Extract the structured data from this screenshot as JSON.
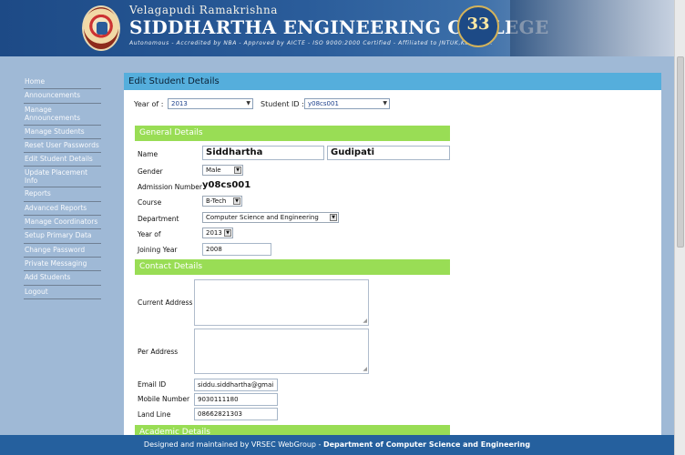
{
  "header": {
    "subtitle": "Velagapudi Ramakrishna",
    "college_name": "SIDDHARTHA ENGINEERING COLLEGE",
    "tagline": "Autonomous - Accredited by NBA - Approved by AICTE - ISO 9000:2000 Certified - Affiliated to JNTUK,Kakinada.",
    "badge_number": "33"
  },
  "sidebar": {
    "items": [
      {
        "label": "Home"
      },
      {
        "label": "Announcements"
      },
      {
        "label": "Manage Announcements"
      },
      {
        "label": "Manage Students"
      },
      {
        "label": "Reset User Passwords"
      },
      {
        "label": "Edit Student Details"
      },
      {
        "label": "Update Placement Info"
      },
      {
        "label": "Reports"
      },
      {
        "label": "Advanced Reports"
      },
      {
        "label": "Manage Coordinators"
      },
      {
        "label": "Setup Primary Data"
      },
      {
        "label": "Change Password"
      },
      {
        "label": "Private Messaging"
      },
      {
        "label": "Add Students"
      },
      {
        "label": "Logout"
      }
    ]
  },
  "panel": {
    "title": "Edit Student Details",
    "filters": {
      "year_label": "Year of :",
      "year_value": "2013",
      "student_id_label": "Student ID :",
      "student_id_value": "y08cs001"
    },
    "general": {
      "heading": "General Details",
      "name_label": "Name",
      "first_name": "Siddhartha",
      "last_name": "Gudipati",
      "gender_label": "Gender",
      "gender_value": "Male",
      "admission_label": "Admission Number",
      "admission_value": "y08cs001",
      "course_label": "Course",
      "course_value": "B-Tech",
      "department_label": "Department",
      "department_value": "Computer Science and Engineering",
      "year_label": "Year of",
      "year_value": "2013",
      "joining_label": "Joining Year",
      "joining_value": "2008"
    },
    "contact": {
      "heading": "Contact Details",
      "current_address_label": "Current Address",
      "per_address_label": "Per Address",
      "email_label": "Email ID",
      "email_value": "siddu.siddhartha@gmai",
      "mobile_label": "Mobile Number",
      "mobile_value": "9030111180",
      "landline_label": "Land Line",
      "landline_value": "08662821303"
    },
    "academic": {
      "heading": "Academic Details"
    }
  },
  "footer": {
    "text": "Designed and maintained by VRSEC WebGroup - ",
    "bold": "Department of Computer Science and Engineering"
  },
  "colors": {
    "header_blue": "#1d4a86",
    "panel_title_blue": "#55aedc",
    "section_green": "#99dd55",
    "page_background": "#9fb9d6",
    "footer_blue": "#25609e"
  }
}
